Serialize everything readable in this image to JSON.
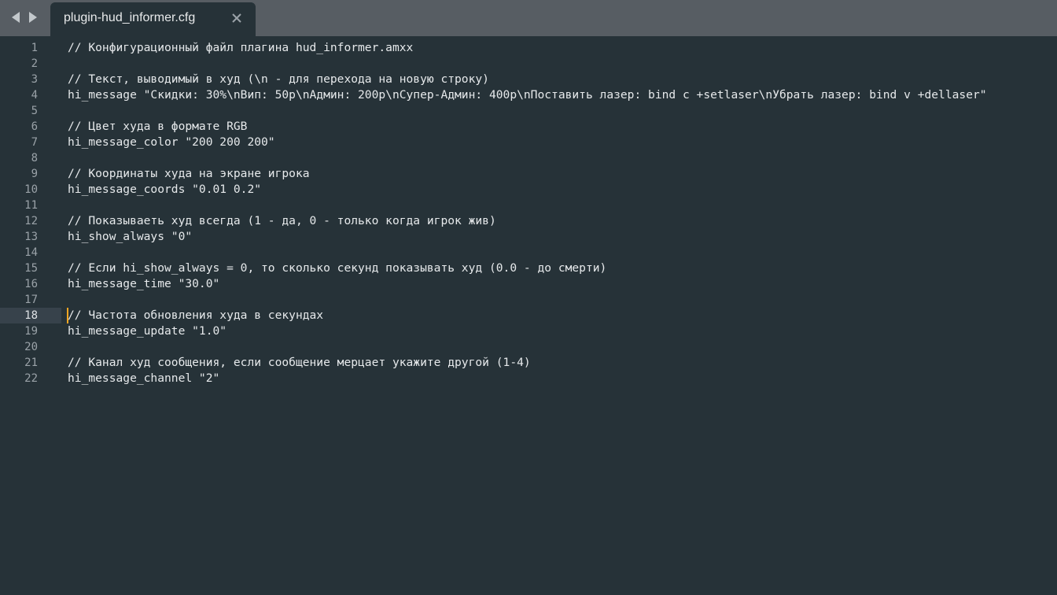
{
  "tab": {
    "filename": "plugin-hud_informer.cfg",
    "close_glyph": "✕"
  },
  "nav": {
    "back_icon": "left-triangle",
    "forward_icon": "right-triangle"
  },
  "editor": {
    "active_line": 18,
    "line_numbers": [
      "1",
      "2",
      "3",
      "4",
      "5",
      "6",
      "7",
      "8",
      "9",
      "10",
      "11",
      "12",
      "13",
      "14",
      "15",
      "16",
      "17",
      "18",
      "19",
      "20",
      "21",
      "22"
    ],
    "lines": [
      "// Конфигурационный файл плагина hud_informer.amxx",
      "",
      "// Текст, выводимый в худ (\\n - для перехода на новую строку)",
      "hi_message \"Скидки: 30%\\nВип: 50р\\nАдмин: 200р\\nСупер-Админ: 400р\\nПоставить лазер: bind c +setlaser\\nУбрать лазер: bind v +dellaser\"",
      "",
      "// Цвет худа в формате RGB",
      "hi_message_color \"200 200 200\"",
      "",
      "// Координаты худа на экране игрока",
      "hi_message_coords \"0.01 0.2\"",
      "",
      "// Показываеть худ всегда (1 - да, 0 - только когда игрок жив)",
      "hi_show_always \"0\"",
      "",
      "// Если hi_show_always = 0, то сколько секунд показывать худ (0.0 - до смерти)",
      "hi_message_time \"30.0\"",
      "",
      "// Частота обновления худа в секундах",
      "hi_message_update \"1.0\"",
      "",
      "// Канал худ сообщения, если сообщение мерцает укажите другой (1-4)",
      "hi_message_channel \"2\""
    ]
  },
  "colors": {
    "background": "#263238",
    "tabbar": "#575d63",
    "caret": "#f5a623",
    "text": "#e6e9eb",
    "line_number": "#9aa2a8"
  }
}
